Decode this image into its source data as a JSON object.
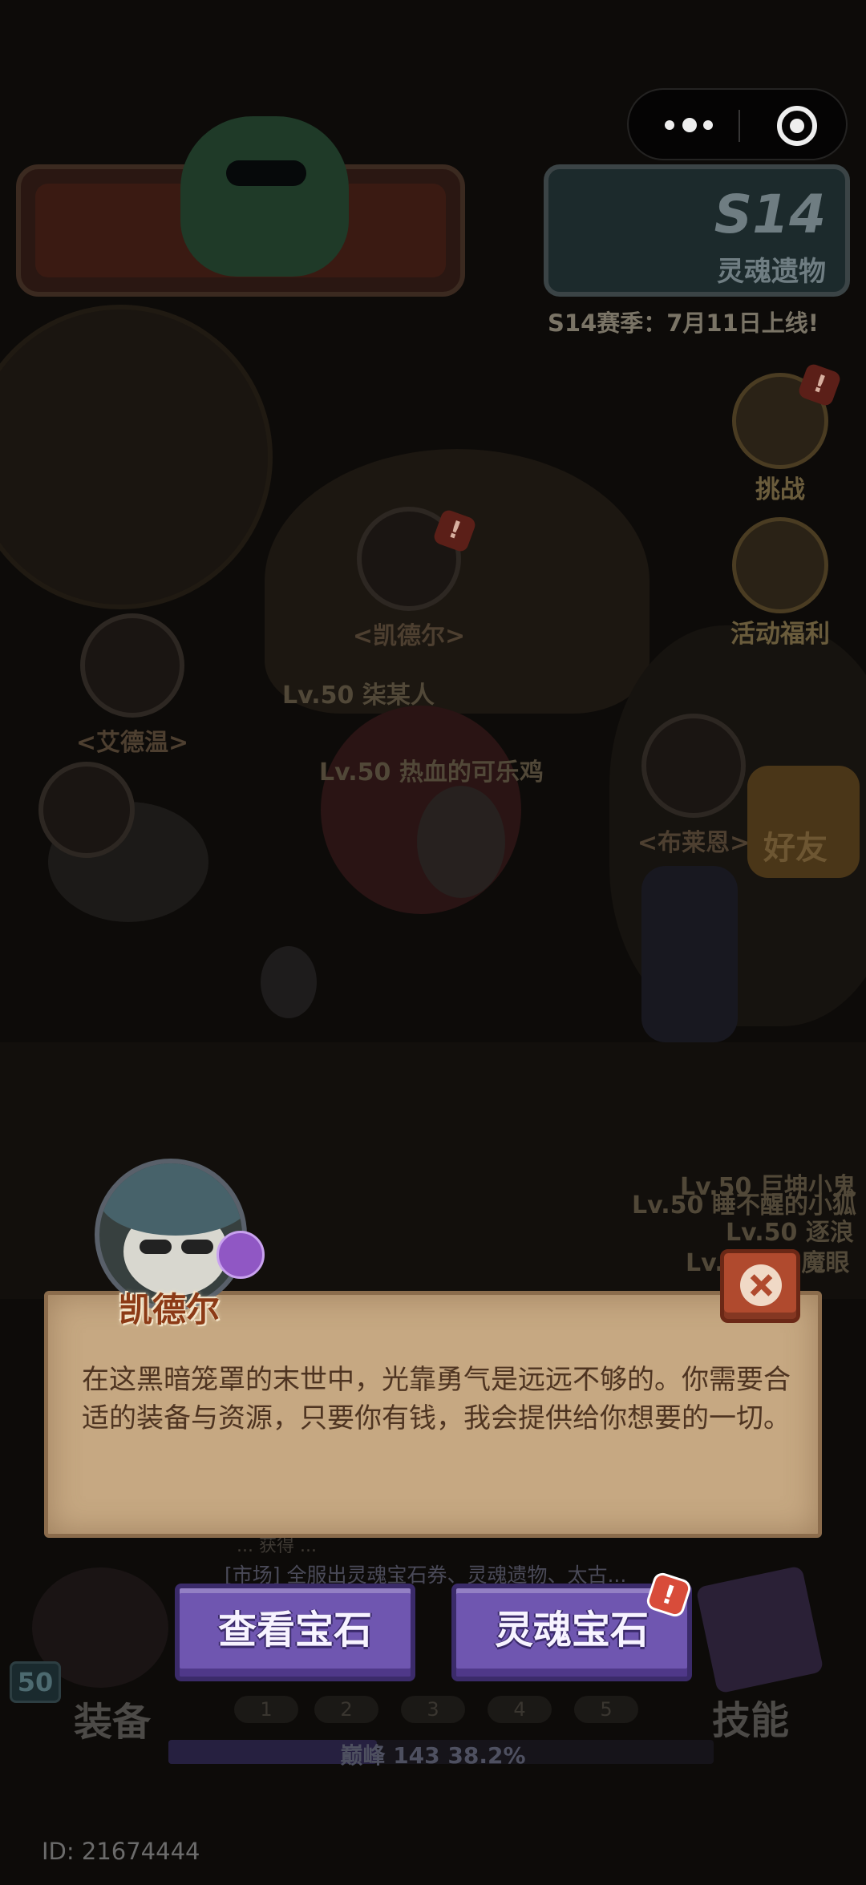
{
  "capsule": {
    "more_icon": "more-dots-icon",
    "close_icon": "target-circle-icon"
  },
  "season": {
    "title": "S14",
    "subtitle": "灵魂遗物",
    "date_text": "S14赛季：7月11日上线!"
  },
  "side_menu": [
    {
      "label": "挑战",
      "icon": "hammer-icon",
      "badge": "!"
    },
    {
      "label": "活动福利",
      "icon": "lantern-icon"
    }
  ],
  "friend_button": {
    "label": "好友"
  },
  "npcs": [
    {
      "name": "<凯德尔>",
      "badge": "!"
    },
    {
      "name": "<艾德温>"
    },
    {
      "name": "<布莱恩>"
    }
  ],
  "players": [
    "Lv.50 柒某人",
    "Lv.50 热血的可乐鸡",
    "Lv.50 巨坤小鬼",
    "Lv.50 睡不醒的小狐",
    "Lv.50 逐浪",
    "Lv.50 ... 魔眼"
  ],
  "dialog": {
    "speaker": "凯德尔",
    "text": "在这黑暗笼罩的末世中，光靠勇气是远远不够的。你需要合适的装备与资源，只要你有钱，我会提供给你想要的一切。"
  },
  "actions": {
    "view_gems": "查看宝石",
    "soul_gems": "灵魂宝石",
    "soul_gems_badge": "!"
  },
  "chat": {
    "line_top": "... 获得 ...",
    "line": "[市场] 全服出灵魂宝石券、灵魂遗物、太古..."
  },
  "hud": {
    "equip_label": "装备",
    "skill_label": "技能",
    "level": "50",
    "slots": [
      "1",
      "2",
      "3",
      "4",
      "5"
    ],
    "peak_text": "巅峰 143   38.2%",
    "peak_progress": 0.382
  },
  "user_id": "ID: 21674444",
  "colors": {
    "accent_purple": "#6f56b0",
    "dialog_bg": "#c6a882",
    "close_red": "#b04a2e"
  }
}
